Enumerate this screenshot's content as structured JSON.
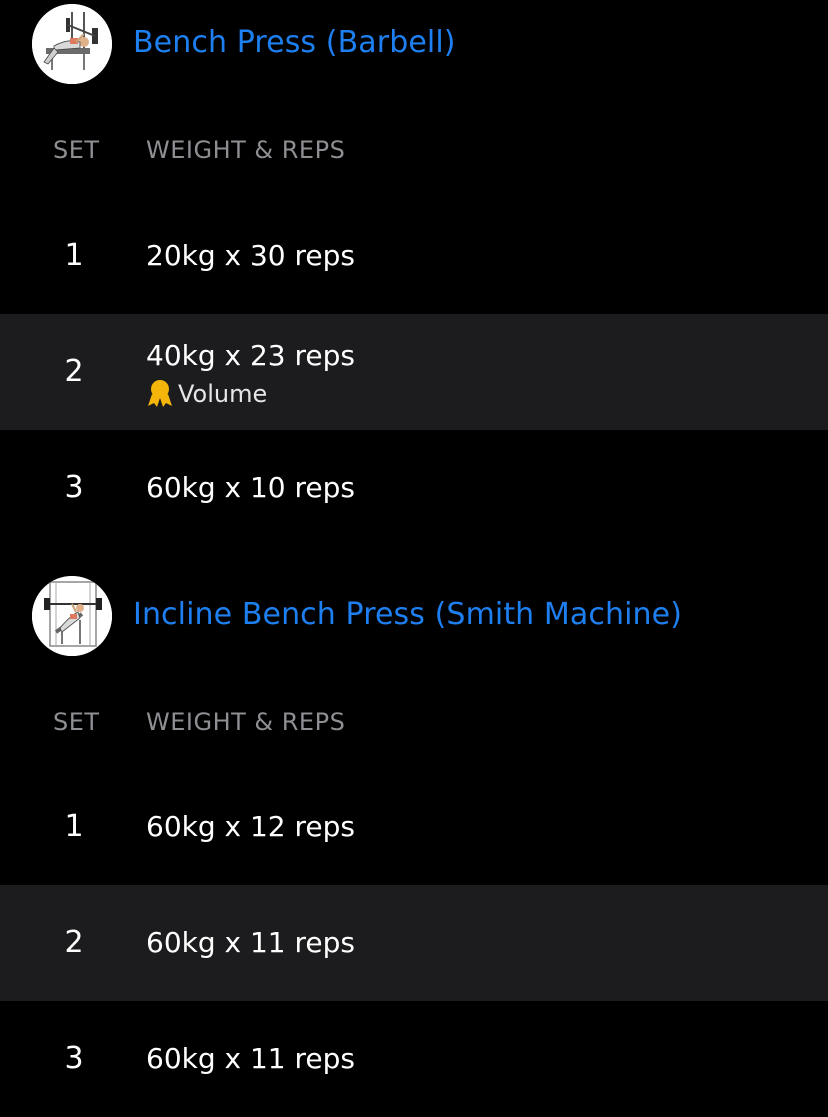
{
  "colors": {
    "background": "#000000",
    "alt_row": "#1c1c1e",
    "accent": "#1e7ff0",
    "header_text": "#8e8e93",
    "medal": "#f5b50a"
  },
  "exercises": [
    {
      "title": "Bench Press (Barbell)",
      "thumbnail_icon": "bench-press-illustration",
      "headers": {
        "set": "SET",
        "weight_reps": "WEIGHT & REPS"
      },
      "sets": [
        {
          "number": "1",
          "value": "20kg x 30 reps"
        },
        {
          "number": "2",
          "value": "40kg x 23 reps",
          "record_icon": "medal-icon",
          "record": "Volume"
        },
        {
          "number": "3",
          "value": "60kg x 10 reps"
        }
      ]
    },
    {
      "title": "Incline Bench Press (Smith Machine)",
      "thumbnail_icon": "smith-machine-incline-illustration",
      "headers": {
        "set": "SET",
        "weight_reps": "WEIGHT & REPS"
      },
      "sets": [
        {
          "number": "1",
          "value": "60kg x 12 reps"
        },
        {
          "number": "2",
          "value": "60kg x 11 reps"
        },
        {
          "number": "3",
          "value": "60kg x 11 reps"
        }
      ]
    }
  ]
}
